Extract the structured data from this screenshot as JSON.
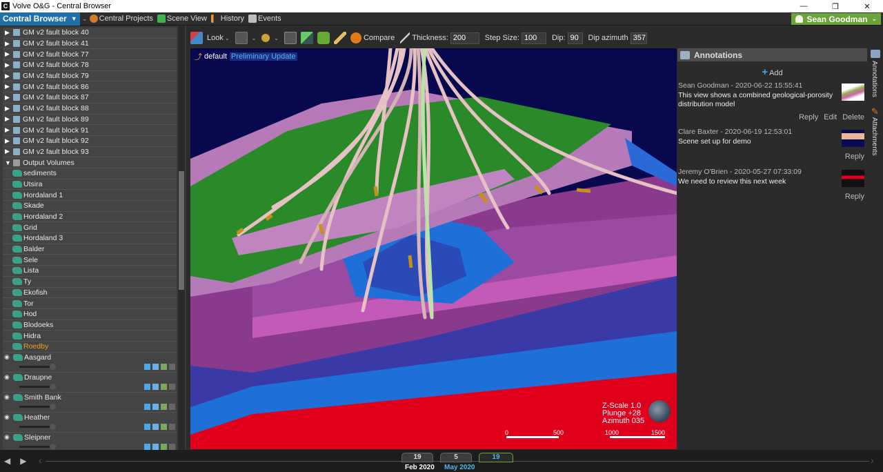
{
  "window": {
    "title": "Volve O&G - Central Browser",
    "app_icon": "C",
    "minimize": "—",
    "restore": "❐",
    "close": "✕"
  },
  "nav": {
    "main": "Central Browser",
    "items": [
      {
        "label": "Central Projects",
        "icon": "projects-icon",
        "color": "#d27a2a"
      },
      {
        "label": "Scene View",
        "icon": "cube-icon",
        "color": "#3fb34f"
      },
      {
        "label": "History",
        "icon": "history-icon",
        "color": "#e89a30"
      },
      {
        "label": "Events",
        "icon": "events-icon",
        "color": "#bfbfbf"
      }
    ],
    "user": "Sean Goodman"
  },
  "tree": {
    "fault_blocks": [
      "GM v2 fault block 40",
      "GM v2 fault block 41",
      "GM v2 fault block 77",
      "GM v2 fault block 78",
      "GM v2 fault block 79",
      "GM v2 fault block 86",
      "GM v2 fault block 87",
      "GM v2 fault block 88",
      "GM v2 fault block 89",
      "GM v2 fault block 91",
      "GM v2 fault block 92",
      "GM v2 fault block 93"
    ],
    "folder": "Output Volumes",
    "volumes": [
      "sediments",
      "Utsira",
      "Hordaland 1",
      "Skade",
      "Hordaland 2",
      "Grid",
      "Hordaland 3",
      "Balder",
      "Sele",
      "Lista",
      "Ty",
      "Ekofish",
      "Tor",
      "Hod",
      "Blodoeks",
      "Hidra",
      "Roedby"
    ],
    "selected": "Roedby",
    "expanded_volumes": [
      "Aasgard",
      "Draupne",
      "Smith Bank",
      "Heather",
      "Sleipner"
    ]
  },
  "toolbar": {
    "look": "Look",
    "compare": "Compare",
    "thickness_label": "Thickness:",
    "thickness_value": "200",
    "step_label": "Step Size:",
    "step_value": "100",
    "dip_label": "Dip:",
    "dip_value": "90",
    "azimuth_label": "Dip azimuth",
    "azimuth_value": "357"
  },
  "viewport": {
    "layer": "default",
    "tag": "Preliminary Update",
    "zscale": "Z-Scale 1.0",
    "plunge": "Plunge +28",
    "azimuth": "Azimuth 035",
    "scale_ticks": [
      "0",
      "500",
      "1000",
      "1500"
    ]
  },
  "annotations": {
    "title": "Annotations",
    "add": "Add",
    "notes": [
      {
        "meta": "Sean Goodman - 2020-06-22 15:55:41",
        "text": "This view shows a combined geological-porosity distribution model",
        "actions": [
          "Reply",
          "Edit",
          "Delete"
        ]
      },
      {
        "meta": "Clare Baxter - 2020-06-19 12:53:01",
        "text": "Scene set up for demo",
        "actions": [
          "Reply"
        ]
      },
      {
        "meta": "Jeremy O'Brien - 2020-05-27 07:33:09",
        "text": "We need to review this next week",
        "actions": [
          "Reply"
        ]
      }
    ],
    "side_tabs": [
      "Annotations",
      "Attachments"
    ]
  },
  "timeline": {
    "tabs": [
      "19",
      "5",
      "19"
    ],
    "months": [
      "Feb 2020",
      "May 2020"
    ]
  }
}
